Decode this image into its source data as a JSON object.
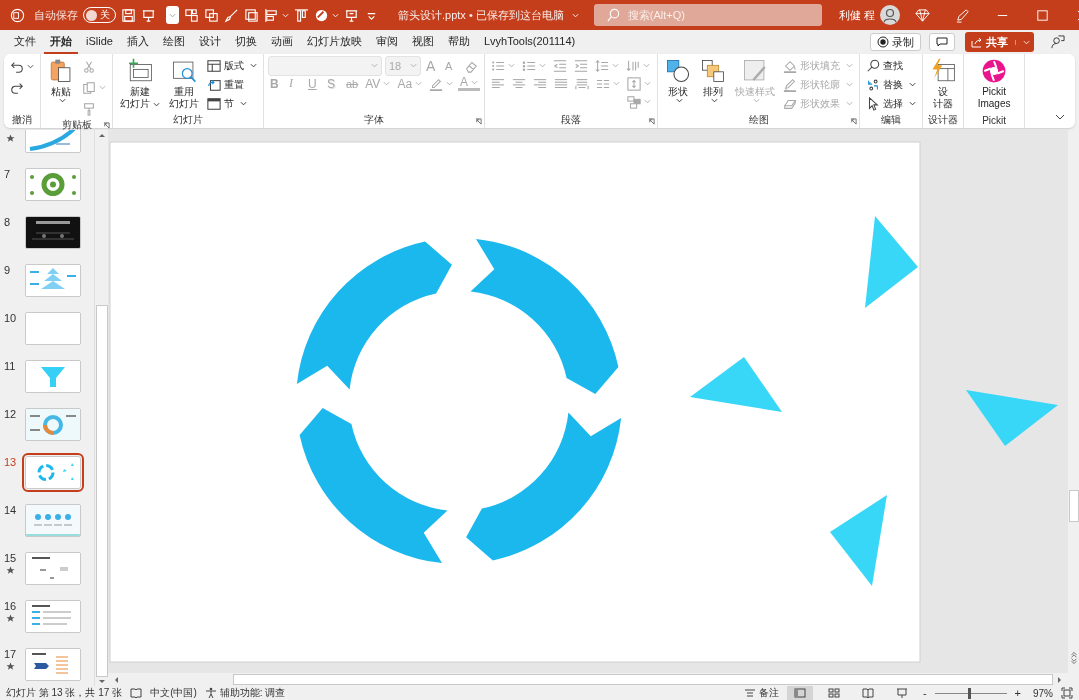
{
  "window": {
    "title": "箭头设计.pptx • 已保存到这台电脑",
    "autosave": {
      "label": "自动保存",
      "on": false,
      "state_text": "关"
    },
    "qat": [
      {
        "kind": "save",
        "dropdown": false
      },
      {
        "kind": "present",
        "dropdown": false
      },
      {
        "kind": "combo",
        "dropdown": true
      },
      {
        "kind": "group-shapes",
        "dropdown": false
      },
      {
        "kind": "bring-forward",
        "dropdown": false
      },
      {
        "kind": "brush",
        "dropdown": false
      },
      {
        "kind": "layers",
        "dropdown": false
      },
      {
        "kind": "align",
        "dropdown": true
      },
      {
        "kind": "align-top",
        "dropdown": false
      },
      {
        "kind": "blob",
        "dropdown": true
      },
      {
        "kind": "easel",
        "dropdown": false
      },
      {
        "kind": "customize",
        "dropdown": false
      }
    ],
    "search": {
      "placeholder": "搜索(Alt+Q)"
    },
    "user": "利健 程"
  },
  "tabs": [
    {
      "label": "文件",
      "selected": false
    },
    {
      "label": "开始",
      "selected": true
    },
    {
      "label": "iSlide",
      "selected": false
    },
    {
      "label": "插入",
      "selected": false
    },
    {
      "label": "绘图",
      "selected": false
    },
    {
      "label": "设计",
      "selected": false
    },
    {
      "label": "切换",
      "selected": false
    },
    {
      "label": "动画",
      "selected": false
    },
    {
      "label": "幻灯片放映",
      "selected": false
    },
    {
      "label": "审阅",
      "selected": false
    },
    {
      "label": "视图",
      "selected": false
    },
    {
      "label": "帮助",
      "selected": false
    },
    {
      "label": "LvyhTools(201114)",
      "selected": false
    }
  ],
  "tab_actions": {
    "record": "录制",
    "share": "共享"
  },
  "ribbon": [
    {
      "label": "撤消",
      "launcher": false,
      "columns": [
        [
          {
            "kind": "undo",
            "dropdown": true,
            "disabled": false
          },
          {
            "kind": "redo",
            "dropdown": false,
            "disabled": false
          }
        ]
      ]
    },
    {
      "label": "剪贴板",
      "launcher": true,
      "columns": [
        [
          {
            "kind": "paste",
            "lines": [
              "粘贴"
            ],
            "dropdown": true,
            "disabled": false
          }
        ],
        [
          {
            "kind": "cut",
            "dropdown": false,
            "disabled": true
          },
          {
            "kind": "copy",
            "dropdown": true,
            "disabled": true
          },
          {
            "kind": "format-painter",
            "dropdown": false,
            "disabled": true
          }
        ]
      ]
    },
    {
      "label": "幻灯片",
      "launcher": false,
      "columns": [
        [
          {
            "kind": "new-slide",
            "lines": [
              "新建",
              "幻灯片"
            ],
            "dropdown": true,
            "disabled": false
          }
        ],
        [
          {
            "kind": "reuse-slide",
            "lines": [
              "重用",
              "幻灯片"
            ],
            "dropdown": false,
            "disabled": false
          }
        ],
        [
          {
            "kind": "layout",
            "label": "版式",
            "dropdown": true,
            "disabled": false
          },
          {
            "kind": "reset",
            "label": "重置",
            "dropdown": false,
            "disabled": false
          },
          {
            "kind": "section",
            "label": "节",
            "dropdown": true,
            "disabled": false
          }
        ]
      ]
    },
    {
      "label": "字体",
      "launcher": true,
      "rows": [
        [
          {
            "kind": "font-name",
            "dropdown": true,
            "disabled": true
          },
          {
            "kind": "font-size",
            "label": "18",
            "dropdown": true,
            "disabled": true
          },
          {
            "kind": "grow-font",
            "label": "A",
            "dropdown": false,
            "disabled": true
          },
          {
            "kind": "shrink-font",
            "label": "A",
            "dropdown": false,
            "disabled": true
          },
          {
            "kind": "clear-format",
            "dropdown": false,
            "disabled": true
          }
        ],
        [
          {
            "kind": "bold",
            "label": "B",
            "dropdown": false,
            "disabled": true
          },
          {
            "kind": "italic",
            "label": "I",
            "dropdown": false,
            "disabled": true
          },
          {
            "kind": "underline",
            "label": "U",
            "dropdown": false,
            "disabled": true
          },
          {
            "kind": "shadow",
            "label": "S",
            "dropdown": false,
            "disabled": true
          },
          {
            "kind": "strikethrough",
            "label": "ab",
            "dropdown": false,
            "disabled": true
          },
          {
            "kind": "spacing",
            "label": "AV",
            "dropdown": true,
            "disabled": true
          },
          {
            "kind": "change-case",
            "label": "Aa",
            "dropdown": true,
            "disabled": true
          },
          {
            "kind": "highlighter",
            "dropdown": true,
            "disabled": true
          },
          {
            "kind": "font-color",
            "label": "A",
            "dropdown": true,
            "disabled": true
          }
        ]
      ]
    },
    {
      "label": "段落",
      "launcher": true,
      "rows": [
        [
          {
            "kind": "bullets",
            "dropdown": true,
            "disabled": true
          },
          {
            "kind": "numbering",
            "dropdown": true,
            "disabled": true
          },
          {
            "kind": "indent-decrease",
            "dropdown": false,
            "disabled": true
          },
          {
            "kind": "indent-increase",
            "dropdown": false,
            "disabled": true
          },
          {
            "kind": "line-spacing",
            "dropdown": true,
            "disabled": true
          },
          {
            "kind": "text-direction",
            "dropdown": true,
            "disabled": true
          }
        ],
        [
          {
            "kind": "align-left",
            "dropdown": false,
            "disabled": true
          },
          {
            "kind": "align-center",
            "dropdown": false,
            "disabled": true
          },
          {
            "kind": "align-right",
            "dropdown": false,
            "disabled": true
          },
          {
            "kind": "justify",
            "dropdown": false,
            "disabled": true
          },
          {
            "kind": "distribute",
            "dropdown": false,
            "disabled": true
          },
          {
            "kind": "columns",
            "dropdown": true,
            "disabled": true
          },
          {
            "kind": "align-text",
            "dropdown": true,
            "disabled": true
          }
        ],
        [
          {
            "kind": "smartart",
            "dropdown": true,
            "disabled": true
          }
        ]
      ]
    },
    {
      "label": "绘图",
      "launcher": true,
      "columns": [
        [
          {
            "kind": "shapes",
            "lines": [
              "形状"
            ],
            "dropdown": true,
            "disabled": false
          }
        ],
        [
          {
            "kind": "arrange",
            "lines": [
              "排列"
            ],
            "dropdown": true,
            "disabled": false
          }
        ],
        [
          {
            "kind": "quick-styles",
            "lines": [
              "快速样式"
            ],
            "dropdown": true,
            "disabled": true
          }
        ],
        [
          {
            "kind": "shape-fill",
            "label": "形状填充",
            "dropdown": true,
            "disabled": true
          },
          {
            "kind": "shape-outline",
            "label": "形状轮廓",
            "dropdown": true,
            "disabled": true
          },
          {
            "kind": "shape-effects",
            "label": "形状效果",
            "dropdown": true,
            "disabled": true
          }
        ]
      ]
    },
    {
      "label": "编辑",
      "launcher": false,
      "columns": [
        [
          {
            "kind": "find",
            "label": "查找",
            "dropdown": false,
            "disabled": false
          },
          {
            "kind": "replace",
            "label": "替换",
            "dropdown": true,
            "disabled": false
          },
          {
            "kind": "select",
            "label": "选择",
            "dropdown": true,
            "disabled": false
          }
        ]
      ]
    },
    {
      "label": "设计器",
      "launcher": false,
      "columns": [
        [
          {
            "kind": "designer",
            "lines": [
              "设",
              "计器"
            ],
            "dropdown": false,
            "disabled": false
          }
        ]
      ]
    },
    {
      "label": "Pickit",
      "launcher": false,
      "columns": [
        [
          {
            "kind": "pickit",
            "lines": [
              "Pickit Images"
            ],
            "dropdown": false,
            "disabled": false
          }
        ]
      ]
    }
  ],
  "slides": [
    {
      "kind": "arrows",
      "starred": true,
      "selected": false
    },
    {
      "number": "7",
      "kind": "wheel",
      "starred": false,
      "selected": false
    },
    {
      "number": "8",
      "kind": "dark",
      "starred": false,
      "selected": false
    },
    {
      "number": "9",
      "kind": "pagoda",
      "starred": false,
      "selected": false
    },
    {
      "number": "10",
      "kind": "blank",
      "starred": false,
      "selected": false
    },
    {
      "number": "11",
      "kind": "funnel",
      "starred": false,
      "selected": false
    },
    {
      "number": "12",
      "kind": "ring-chart",
      "starred": false,
      "selected": false
    },
    {
      "number": "13",
      "kind": "ring-arrows",
      "starred": false,
      "selected": true
    },
    {
      "number": "14",
      "kind": "steps",
      "starred": false,
      "selected": false
    },
    {
      "number": "15",
      "kind": "text",
      "starred": true,
      "selected": false
    },
    {
      "number": "16",
      "kind": "list",
      "starred": true,
      "selected": false
    },
    {
      "number": "17",
      "kind": "chevron",
      "starred": true,
      "selected": false
    }
  ],
  "status_bar": {
    "slide_position": "幻灯片 第 13 张，共 17 张",
    "language": "中文(中国)",
    "accessibility": "辅助功能: 调查",
    "notes": "备注",
    "views": [
      {
        "kind": "normal",
        "selected": true
      },
      {
        "kind": "sorter",
        "selected": false
      },
      {
        "kind": "reading",
        "selected": false
      },
      {
        "kind": "slideshow",
        "selected": false
      }
    ],
    "zoom_out": "-",
    "zoom_in": "+",
    "zoom": {
      "level": 0.48
    },
    "zoom_text": "97%"
  }
}
